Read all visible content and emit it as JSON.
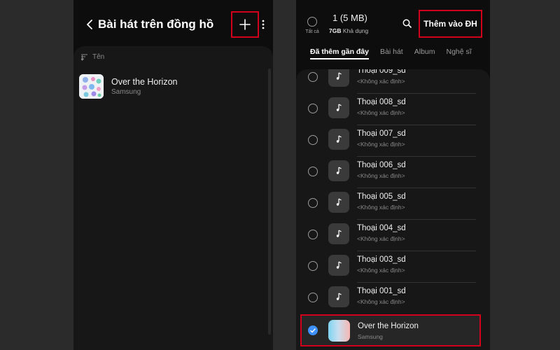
{
  "left_screen": {
    "title": "Bài hát trên đồng hồ",
    "sort_label": "Tên",
    "songs": [
      {
        "title": "Over the Horizon",
        "artist": "Samsung"
      }
    ]
  },
  "right_screen": {
    "select_all_label": "Tất cả",
    "selected_count": "1 (5 MB)",
    "storage_amount": "7GB",
    "storage_label": "Khả dụng",
    "add_button_label": "Thêm vào ĐH",
    "tabs": [
      {
        "label": "Đã thêm gần đây",
        "active": true
      },
      {
        "label": "Bài hát",
        "active": false
      },
      {
        "label": "Album",
        "active": false
      },
      {
        "label": "Nghệ sĩ",
        "active": false
      }
    ],
    "tracks": [
      {
        "title": "Thoại 009_sd",
        "subtitle": "<Không xác định>",
        "checked": false
      },
      {
        "title": "Thoại 008_sd",
        "subtitle": "<Không xác định>",
        "checked": false
      },
      {
        "title": "Thoại 007_sd",
        "subtitle": "<Không xác định>",
        "checked": false
      },
      {
        "title": "Thoại 006_sd",
        "subtitle": "<Không xác định>",
        "checked": false
      },
      {
        "title": "Thoại 005_sd",
        "subtitle": "<Không xác định>",
        "checked": false
      },
      {
        "title": "Thoại 004_sd",
        "subtitle": "<Không xác định>",
        "checked": false
      },
      {
        "title": "Thoại 003_sd",
        "subtitle": "<Không xác định>",
        "checked": false
      },
      {
        "title": "Thoại 001_sd",
        "subtitle": "<Không xác định>",
        "checked": false
      }
    ],
    "selected_track": {
      "title": "Over the Horizon",
      "subtitle": "Samsung",
      "checked": true
    }
  },
  "colors": {
    "highlight_border": "#d0021b",
    "check_accent": "#3e91ff",
    "background": "#0d0d0d",
    "list_background": "#171717"
  },
  "icons": [
    "back-arrow-icon",
    "plus-icon",
    "more-vertical-icon",
    "sort-icon",
    "search-icon",
    "music-note-icon",
    "checkmark-icon"
  ]
}
